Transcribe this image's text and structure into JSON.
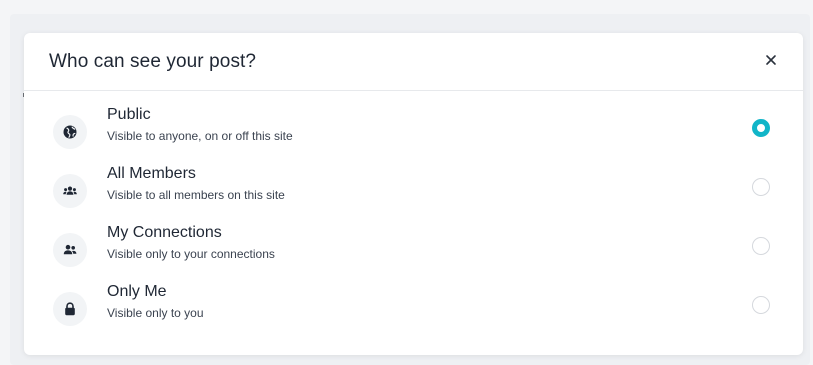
{
  "dialog": {
    "title": "Who can see your post?",
    "close_icon": "close-icon"
  },
  "options": [
    {
      "title": "Public",
      "description": "Visible to anyone, on or off this site",
      "icon": "globe-icon",
      "selected": true
    },
    {
      "title": "All Members",
      "description": "Visible to all members on this site",
      "icon": "group-icon",
      "selected": false
    },
    {
      "title": "My Connections",
      "description": "Visible only to your connections",
      "icon": "connections-icon",
      "selected": false
    },
    {
      "title": "Only Me",
      "description": "Visible only to you",
      "icon": "lock-icon",
      "selected": false
    }
  ],
  "colors": {
    "accent": "#11b5c8",
    "text": "#1f2734",
    "icon_bg": "#f2f4f6"
  }
}
